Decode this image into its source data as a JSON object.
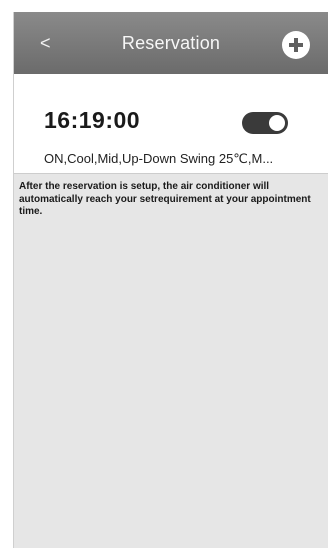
{
  "header": {
    "back_label": "<",
    "title": "Reservation",
    "add_icon": "plus-icon"
  },
  "reservation": {
    "time": "16:19:00",
    "enabled": true,
    "details": "ON,Cool,Mid,Up-Down Swing 25℃,M..."
  },
  "info": {
    "message": "After the reservation is setup, the air conditioner will automatically reach your setrequirement at your appointment time."
  },
  "colors": {
    "header_bg": "#7a7a7a",
    "toggle_on": "#3a3a3a",
    "page_bg": "#e6e6e6"
  }
}
